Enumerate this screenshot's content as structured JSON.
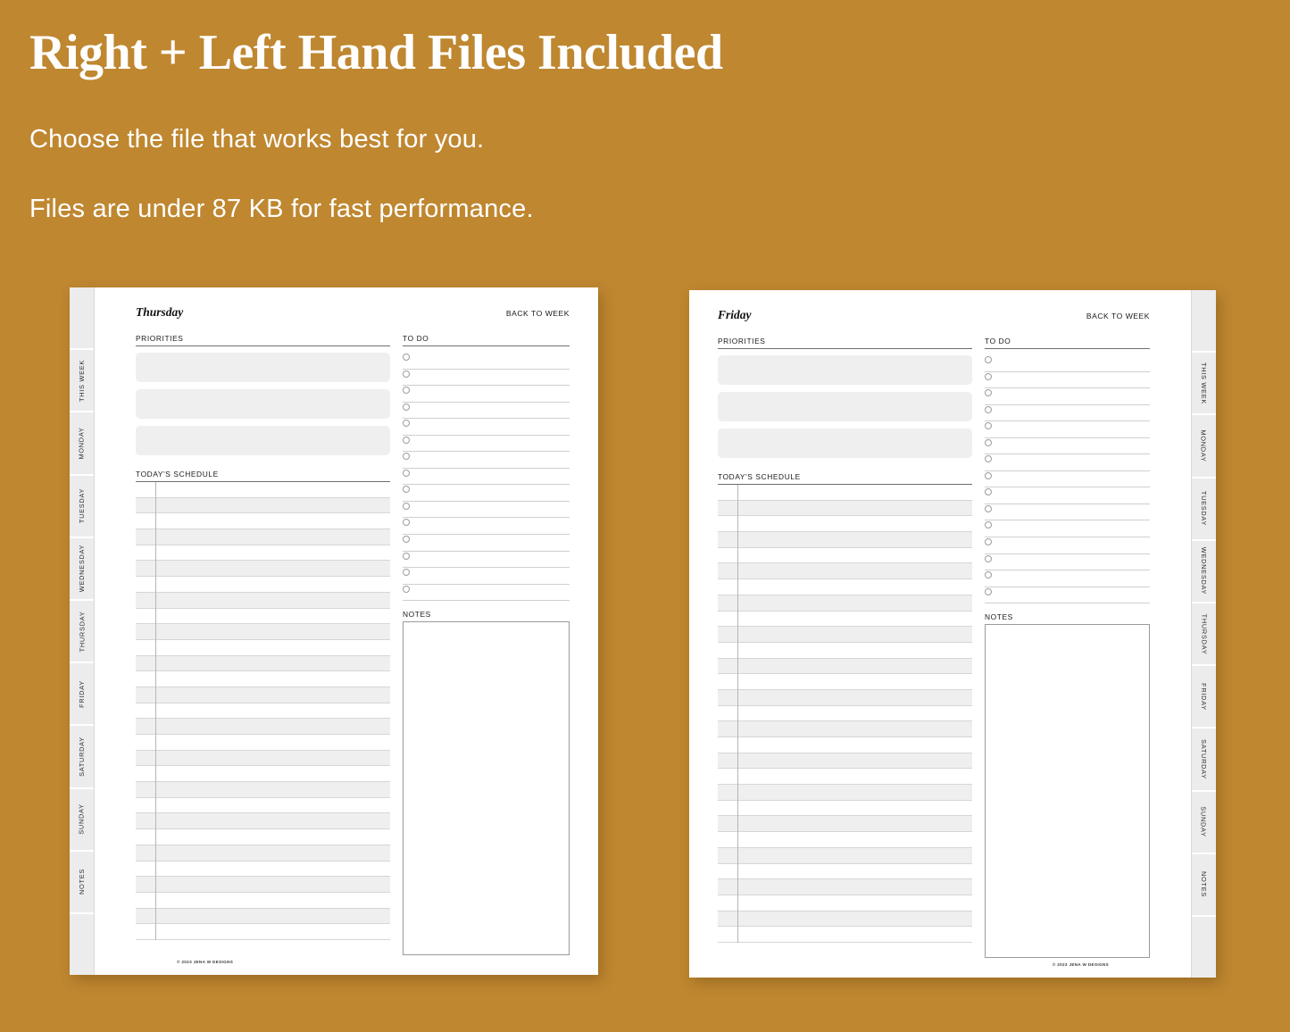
{
  "promo": {
    "background_color": "#bf8730",
    "text_color": "#ffffff",
    "headline": "Right + Left Hand Files Included",
    "subline_1": "Choose the file that works best for you.",
    "subline_2": "Files are under 87 KB for fast performance."
  },
  "tabs": [
    "",
    "THIS WEEK",
    "MONDAY",
    "TUESDAY",
    "WEDNESDAY",
    "THURSDAY",
    "FRIDAY",
    "SATURDAY",
    "SUNDAY",
    "NOTES",
    ""
  ],
  "left_page": {
    "tab_side": "left",
    "day_title": "Thursday",
    "back_to_week": "BACK TO WEEK",
    "priorities_label": "PRIORITIES",
    "priorities_count": 3,
    "schedule_label": "TODAY'S SCHEDULE",
    "schedule_rows": 29,
    "todo_label": "TO DO",
    "todo_count": 15,
    "notes_label": "NOTES",
    "footer": "© 2023 JENA W DESIGNS"
  },
  "right_page": {
    "tab_side": "right",
    "day_title": "Friday",
    "back_to_week": "BACK TO WEEK",
    "priorities_label": "PRIORITIES",
    "priorities_count": 3,
    "schedule_label": "TODAY'S SCHEDULE",
    "schedule_rows": 29,
    "todo_label": "TO DO",
    "todo_count": 15,
    "notes_label": "NOTES",
    "footer": "© 2023 JENA W DESIGNS"
  }
}
